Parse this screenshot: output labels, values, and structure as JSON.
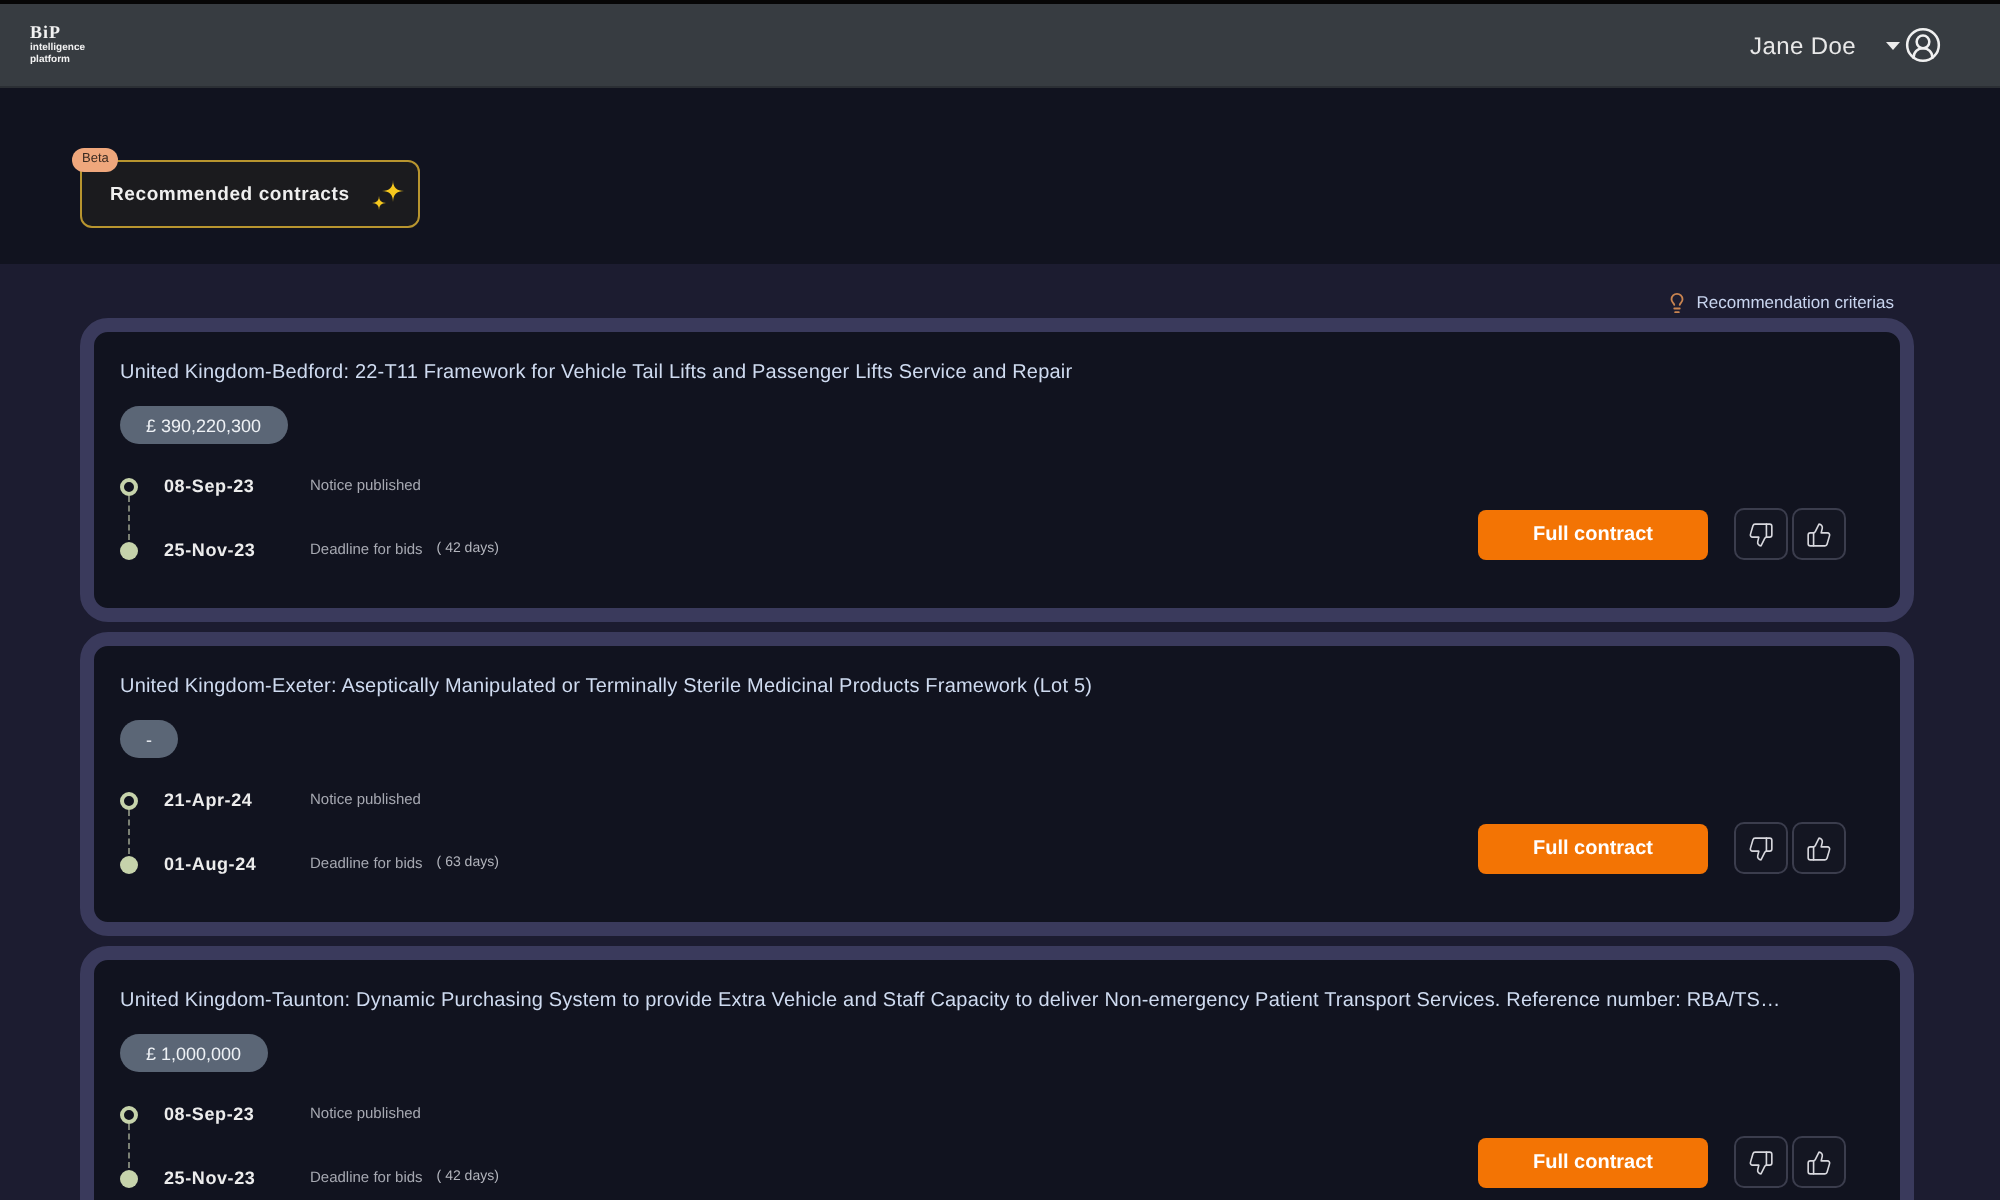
{
  "header": {
    "logo": {
      "mark": "BiP",
      "tagline": "intelligence platform"
    },
    "user": {
      "name": "Jane Doe"
    }
  },
  "hero": {
    "feature": {
      "badge": "Beta",
      "label": "Recommended contracts"
    }
  },
  "criteria_link": {
    "label": "Recommendation criterias"
  },
  "contracts": [
    {
      "title": "United Kingdom-Bedford: 22-T11 Framework for Vehicle Tail Lifts and Passenger Lifts Service and Repair",
      "value": "£ 390,220,300",
      "events": [
        {
          "kind": "published",
          "date": "08-Sep-23",
          "label": "Notice published"
        },
        {
          "kind": "deadline",
          "date": "25-Nov-23",
          "label": "Deadline for bids",
          "note": "( 42 days)"
        }
      ],
      "action": "Full contract"
    },
    {
      "title": "United Kingdom-Exeter: Aseptically Manipulated or Terminally Sterile Medicinal Products Framework (Lot 5)",
      "value": "-",
      "events": [
        {
          "kind": "published",
          "date": "21-Apr-24",
          "label": "Notice published"
        },
        {
          "kind": "deadline",
          "date": "01-Aug-24",
          "label": "Deadline for bids",
          "note": "( 63 days)"
        }
      ],
      "action": "Full contract"
    },
    {
      "title": "United Kingdom-Taunton: Dynamic Purchasing System to provide Extra Vehicle and Staff Capacity to deliver Non-emergency Patient Transport Services. Reference number: RBA/TS…",
      "value": "£ 1,000,000",
      "events": [
        {
          "kind": "published",
          "date": "08-Sep-23",
          "label": "Notice published"
        },
        {
          "kind": "deadline",
          "date": "25-Nov-23",
          "label": "Deadline for bids",
          "note": "( 42 days)"
        }
      ],
      "action": "Full contract"
    }
  ]
}
